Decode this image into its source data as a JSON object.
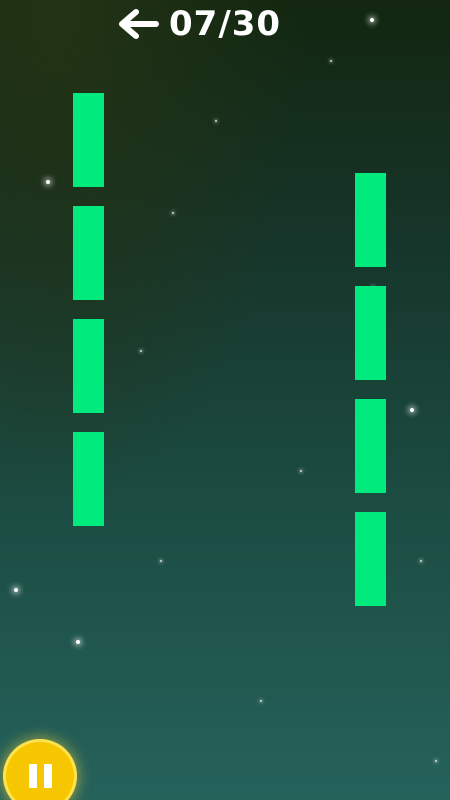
{
  "hud": {
    "back_icon": "arrow-left-icon",
    "level_current": "07",
    "level_separator": "/",
    "level_total": "30"
  },
  "columns": {
    "left": {
      "segments": 4
    },
    "right": {
      "segments": 4
    }
  },
  "colors": {
    "segment": "#00ea7e",
    "pause_button": "#f6c700"
  },
  "controls": {
    "pause_icon": "pause-icon"
  }
}
